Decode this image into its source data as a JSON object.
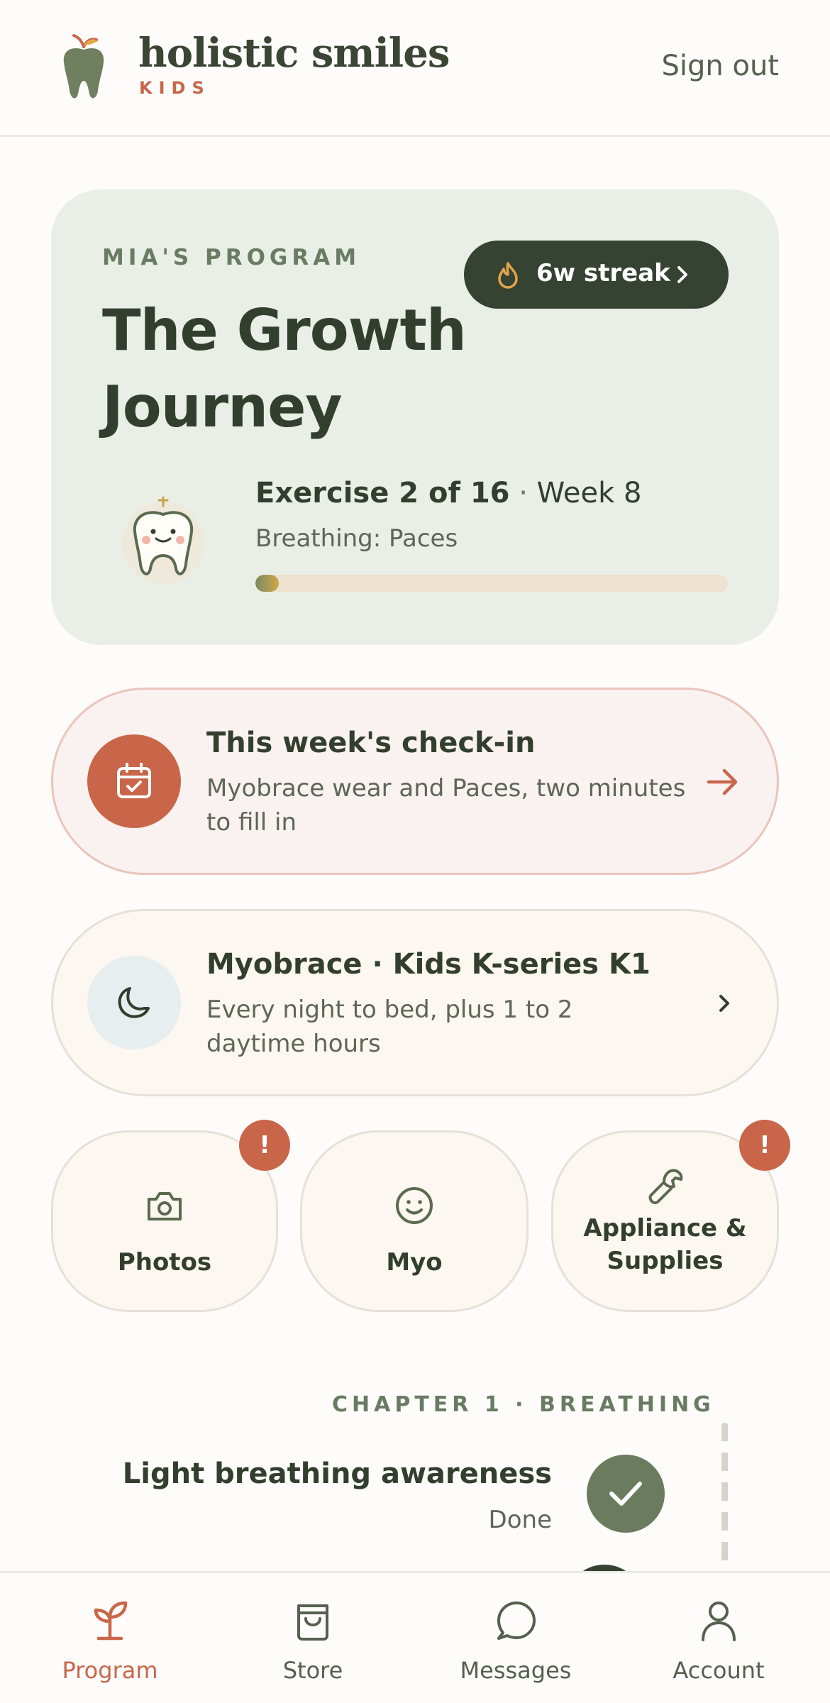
{
  "header": {
    "brand_name": "holistic smiles",
    "brand_sub": "KIDS",
    "signout_label": "Sign out"
  },
  "program": {
    "eyebrow": "MIA'S PROGRAM",
    "title": "The Growth Journey",
    "streak_label": "6w streak",
    "exercise_label": "Exercise 2 of 16",
    "separator": "·",
    "week_label": "Week 8",
    "exercise_name": "Breathing: Paces",
    "progress_fraction": 0.05
  },
  "checkin": {
    "title": "This week's check-in",
    "subtitle": "Myobrace wear and Paces, two minutes to fill in",
    "icon": "calendar-check-icon"
  },
  "appliance": {
    "title": "Myobrace · Kids K-series K1",
    "subtitle": "Every night to bed, plus 1 to 2 daytime hours",
    "icon": "moon-icon"
  },
  "tiles": [
    {
      "label": "Photos",
      "icon": "camera-icon",
      "badge": "!"
    },
    {
      "label": "Myo",
      "icon": "smile-icon",
      "badge": ""
    },
    {
      "label": "Appliance & Supplies",
      "icon": "wrench-icon",
      "badge": "!"
    }
  ],
  "timeline": {
    "chapter": "CHAPTER 1 · BREATHING",
    "lessons": [
      {
        "title": "Light breathing awareness",
        "status": "Done"
      }
    ]
  },
  "nav": [
    {
      "label": "Program",
      "icon": "sprout-icon",
      "active": true
    },
    {
      "label": "Store",
      "icon": "bag-icon",
      "active": false
    },
    {
      "label": "Messages",
      "icon": "chat-icon",
      "active": false
    },
    {
      "label": "Account",
      "icon": "user-icon",
      "active": false
    }
  ],
  "colors": {
    "accent": "#c9664a",
    "dark_green": "#364232",
    "hero_bg": "#e9efe6",
    "sage": "#6b7c5e"
  }
}
